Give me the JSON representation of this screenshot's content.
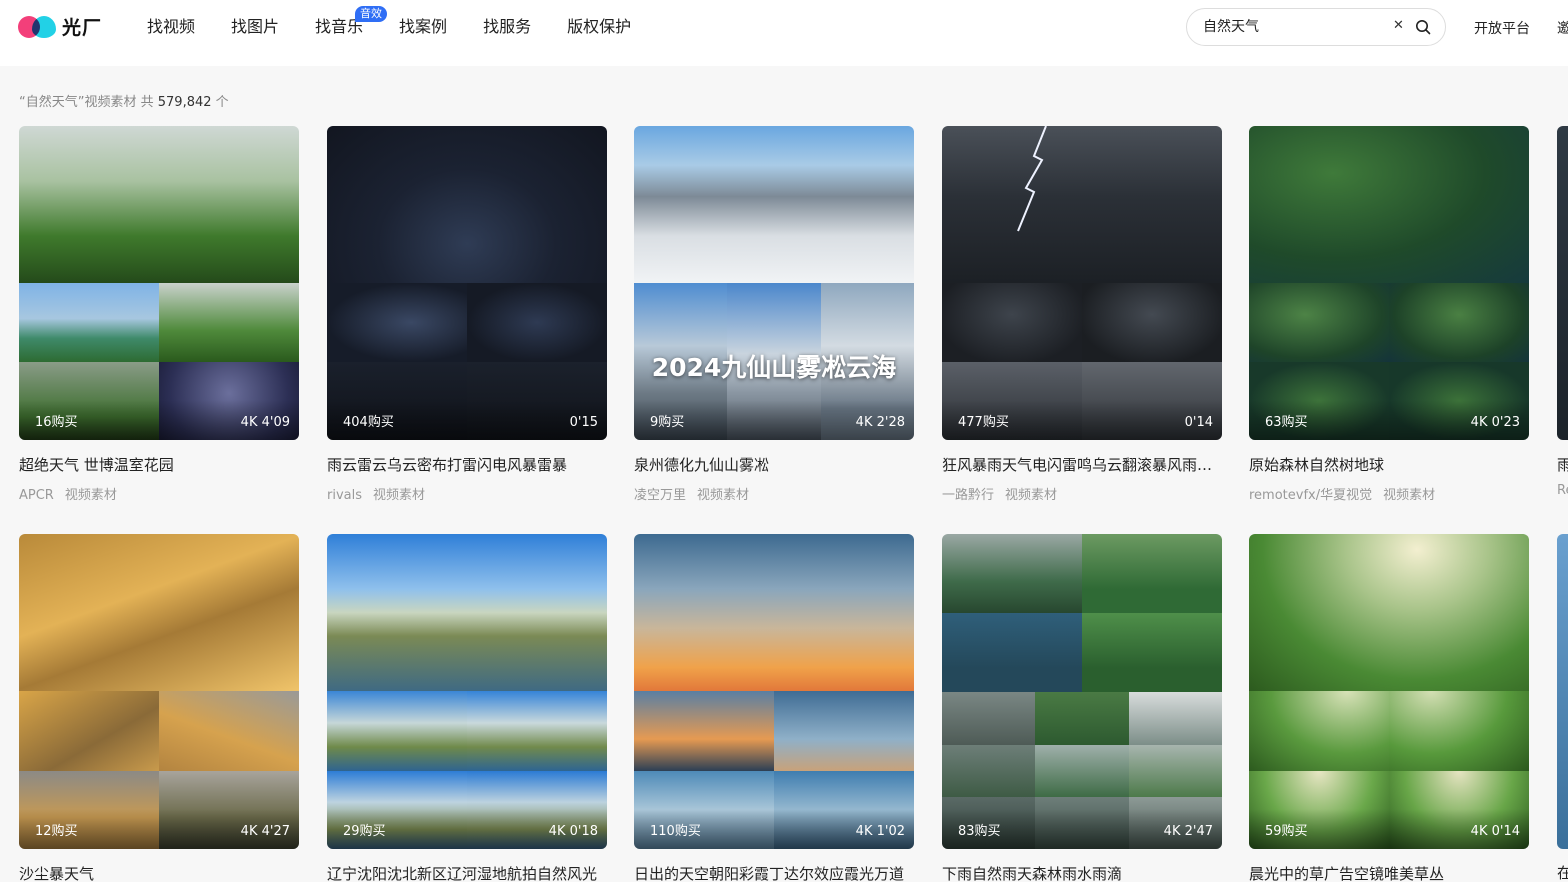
{
  "brand": {
    "name": "光厂"
  },
  "nav": [
    {
      "label": "找视频"
    },
    {
      "label": "找图片"
    },
    {
      "label": "找音乐",
      "badge": "音效"
    },
    {
      "label": "找案例"
    },
    {
      "label": "找服务"
    },
    {
      "label": "版权保护"
    }
  ],
  "search": {
    "value": "自然天气",
    "clear_icon": "close-icon",
    "search_icon": "search-icon"
  },
  "top_links": {
    "open_platform": "开放平台",
    "truncated": "邀"
  },
  "results": {
    "prefix": "“自然天气”视频素材 共 ",
    "count": "579,842",
    "suffix": " 个"
  },
  "cards_row1": [
    {
      "buyers": "16购买",
      "duration": "4K  4'09",
      "title": "超绝天气 世博温室花园",
      "author": "APCR",
      "type": "视频素材"
    },
    {
      "buyers": "404购买",
      "duration": "0'15",
      "title": "雨云雷云乌云密布打雷闪电风暴雷暴",
      "author": "rivals",
      "type": "视频素材"
    },
    {
      "buyers": "9购买",
      "duration": "4K  2'28",
      "title": "泉州德化九仙山雾凇",
      "author": "凌空万里",
      "type": "视频素材",
      "overlay": "2024九仙山雾凇云海"
    },
    {
      "buyers": "477购买",
      "duration": "0'14",
      "title": "狂风暴雨天气电闪雷鸣乌云翻滚暴风雨黑云",
      "author": "一路黔行",
      "type": "视频素材"
    },
    {
      "buyers": "63购买",
      "duration": "4K  0'23",
      "title": "原始森林自然树地球",
      "author": "remotevfx/华夏视觉",
      "type": "视频素材"
    }
  ],
  "cards_row2": [
    {
      "buyers": "12购买",
      "duration": "4K  4'27",
      "title": "沙尘暴天气"
    },
    {
      "buyers": "29购买",
      "duration": "4K  0'18",
      "title": "辽宁沈阳沈北新区辽河湿地航拍自然风光"
    },
    {
      "buyers": "110购买",
      "duration": "4K  1'02",
      "title": "日出的天空朝阳彩霞丁达尔效应霞光万道"
    },
    {
      "buyers": "83购买",
      "duration": "4K  2'47",
      "title": "下雨自然雨天森林雨水雨滴"
    },
    {
      "buyers": "59购买",
      "duration": "4K  0'14",
      "title": "晨光中的草广告空镜唯美草丛"
    }
  ],
  "peek_row1": {
    "title": "雨",
    "author": "Re"
  },
  "peek_row2": {
    "title": "在"
  }
}
